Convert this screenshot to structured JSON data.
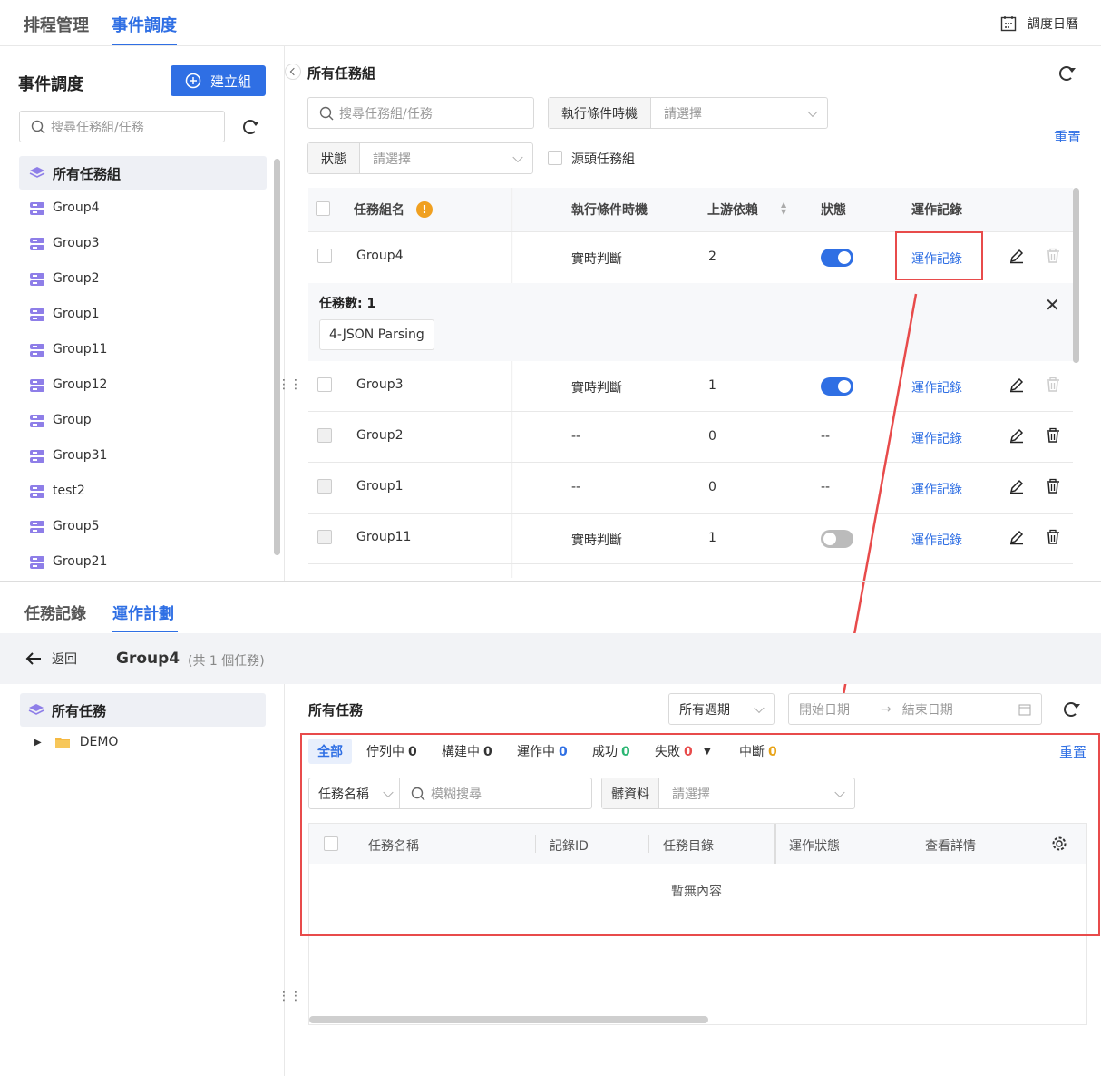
{
  "top_tabs": [
    "排程管理",
    "事件調度"
  ],
  "calendar_label": "調度日曆",
  "sidebar": {
    "title": "事件調度",
    "create_btn": "建立組",
    "search_placeholder": "搜尋任務組/任務",
    "all_label": "所有任務組",
    "groups": [
      "Group4",
      "Group3",
      "Group2",
      "Group1",
      "Group11",
      "Group12",
      "Group",
      "Group31",
      "test2",
      "Group5",
      "Group21"
    ]
  },
  "main": {
    "title": "所有任務組",
    "search_placeholder": "搜尋任務組/任務",
    "cond_label": "執行條件時機",
    "cond_placeholder": "請選擇",
    "reset": "重置",
    "status_label": "狀態",
    "status_placeholder": "請選擇",
    "source_label": "源頭任務組",
    "headers": [
      "任務組名",
      "執行條件時機",
      "上游依賴",
      "狀態",
      "運作記錄"
    ],
    "rows": [
      {
        "name": "Group4",
        "cond": "實時判斷",
        "up": "2",
        "status": "on",
        "log": "運作記錄"
      },
      {
        "name": "Group3",
        "cond": "實時判斷",
        "up": "1",
        "status": "on",
        "log": "運作記錄"
      },
      {
        "name": "Group2",
        "cond": "--",
        "up": "0",
        "status": "--",
        "log": "運作記錄"
      },
      {
        "name": "Group1",
        "cond": "--",
        "up": "0",
        "status": "--",
        "log": "運作記錄"
      },
      {
        "name": "Group11",
        "cond": "實時判斷",
        "up": "1",
        "status": "off",
        "log": "運作記錄"
      }
    ],
    "expand_count_label": "任務數:",
    "expand_count": "1",
    "expand_tag": "4-JSON Parsing"
  },
  "bottom": {
    "tabs": [
      "任務記錄",
      "運作計劃"
    ],
    "back": "返回",
    "group": "Group4",
    "group_meta": "(共 1 個任務)",
    "tree_all": "所有任務",
    "tree_folder": "DEMO",
    "title": "所有任務",
    "period": "所有週期",
    "start_date": "開始日期",
    "end_date": "結束日期",
    "filters": [
      {
        "label": "全部",
        "count": "",
        "color": "#2f6fe4"
      },
      {
        "label": "佇列中",
        "count": "0",
        "color": "#333"
      },
      {
        "label": "構建中",
        "count": "0",
        "color": "#333"
      },
      {
        "label": "運作中",
        "count": "0",
        "color": "#2f6fe4"
      },
      {
        "label": "成功",
        "count": "0",
        "color": "#2bb673"
      },
      {
        "label": "失敗",
        "count": "0",
        "color": "#e84b4b"
      },
      {
        "label": "中斷",
        "count": "0",
        "color": "#e8a317"
      }
    ],
    "reset": "重置",
    "task_name_sel": "任務名稱",
    "fuzzy_placeholder": "模糊搜尋",
    "resource_label": "髒資料",
    "resource_placeholder": "請選擇",
    "headers": [
      "任務名稱",
      "記錄ID",
      "任務目錄",
      "運作狀態",
      "查看詳情"
    ],
    "empty": "暫無內容"
  }
}
